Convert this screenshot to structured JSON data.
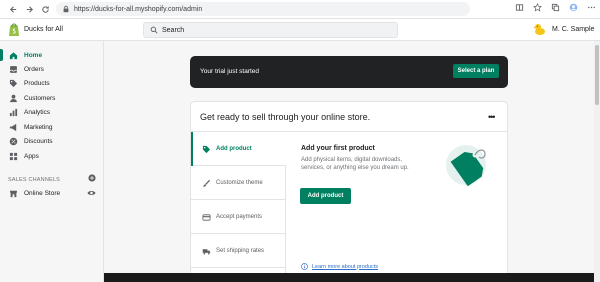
{
  "browser": {
    "url": "https://ducks-for-all.myshopify.com/admin",
    "icons": [
      "back-arrow-icon",
      "forward-arrow-icon",
      "refresh-icon",
      "lock-icon",
      "reading-mode-icon",
      "favorites-icon",
      "collections-icon",
      "profile-icon",
      "more-icon"
    ]
  },
  "topbar": {
    "store_name": "Ducks for All",
    "search_placeholder": "Search",
    "user_name": "M. C. Sample"
  },
  "sidebar": {
    "items": [
      {
        "label": "Home",
        "icon": "home-icon"
      },
      {
        "label": "Orders",
        "icon": "orders-icon"
      },
      {
        "label": "Products",
        "icon": "tag-icon"
      },
      {
        "label": "Customers",
        "icon": "customers-icon"
      },
      {
        "label": "Analytics",
        "icon": "analytics-icon"
      },
      {
        "label": "Marketing",
        "icon": "marketing-icon"
      },
      {
        "label": "Discounts",
        "icon": "discount-icon"
      },
      {
        "label": "Apps",
        "icon": "apps-icon"
      }
    ],
    "sales_heading": "SALES CHANNELS",
    "online_store": "Online Store"
  },
  "banner": {
    "text": "Your trial just started",
    "button": "Select a plan"
  },
  "setup_card": {
    "title": "Get ready to sell through your online store.",
    "more": "•••",
    "steps": [
      {
        "label": "Add product",
        "icon": "tag-icon"
      },
      {
        "label": "Customize theme",
        "icon": "brush-icon"
      },
      {
        "label": "Accept payments",
        "icon": "card-icon"
      },
      {
        "label": "Set shipping rates",
        "icon": "truck-icon"
      }
    ],
    "detail_title": "Add your first product",
    "detail_desc": "Add physical items, digital downloads, services, or anything else you dream up.",
    "detail_button": "Add product",
    "learn_more": "Learn more about products"
  },
  "colors": {
    "accent": "#008060",
    "banner_bg": "#202223",
    "link": "#2c6ecb"
  }
}
